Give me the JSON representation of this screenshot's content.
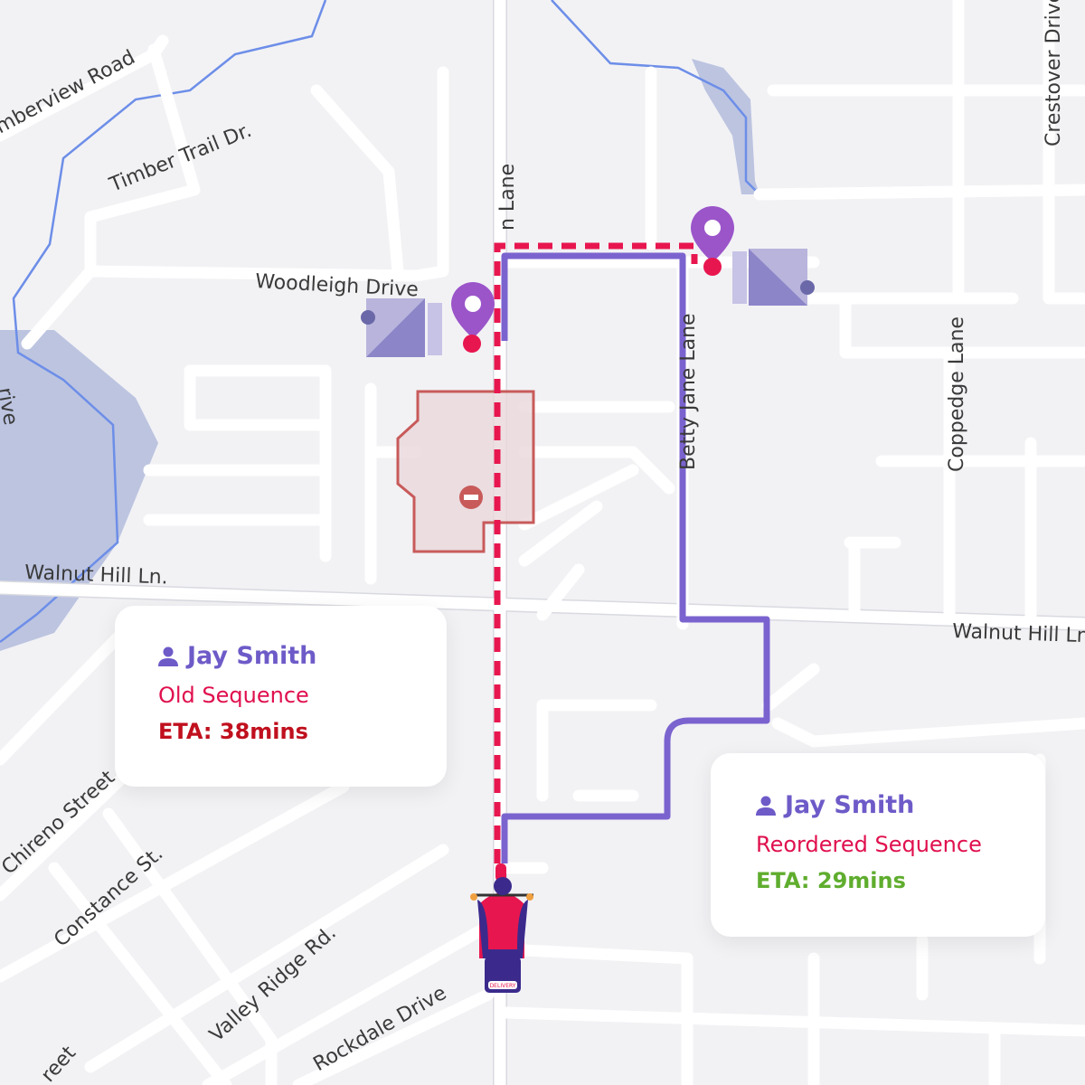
{
  "colors": {
    "old_route": "#e8164f",
    "new_route": "#7b63cf",
    "pin": "#9b55c9",
    "blocked": "#c85a5a",
    "old_eta": "#c0101e",
    "new_eta": "#5fad2e",
    "name": "#6e5bc8"
  },
  "streets": {
    "s1": "mberview Road",
    "s2": "Timber Trail Dr.",
    "s3": "Woodleigh Drive",
    "s4": "n Lane",
    "s5": "Betty Jane Lane",
    "s6": "Coppedge Lane",
    "s7": "Crestover Drive",
    "s8": "Walnut Hill Ln.",
    "s9": "Walnut Hill Ln",
    "s10": "Chireno Street",
    "s11": "Constance St.",
    "s12": "Valley Ridge Rd.",
    "s13": "Rockdale Drive",
    "s14": "reet",
    "s15": "rive"
  },
  "old_card": {
    "icon": "user-icon",
    "name": "Jay Smith",
    "sequence": "Old Sequence",
    "eta": "ETA: 38mins"
  },
  "new_card": {
    "icon": "user-icon",
    "name": "Jay Smith",
    "sequence": "Reordered Sequence",
    "eta": "ETA: 29mins"
  },
  "rider": {
    "box_label": "DELIVERY"
  }
}
